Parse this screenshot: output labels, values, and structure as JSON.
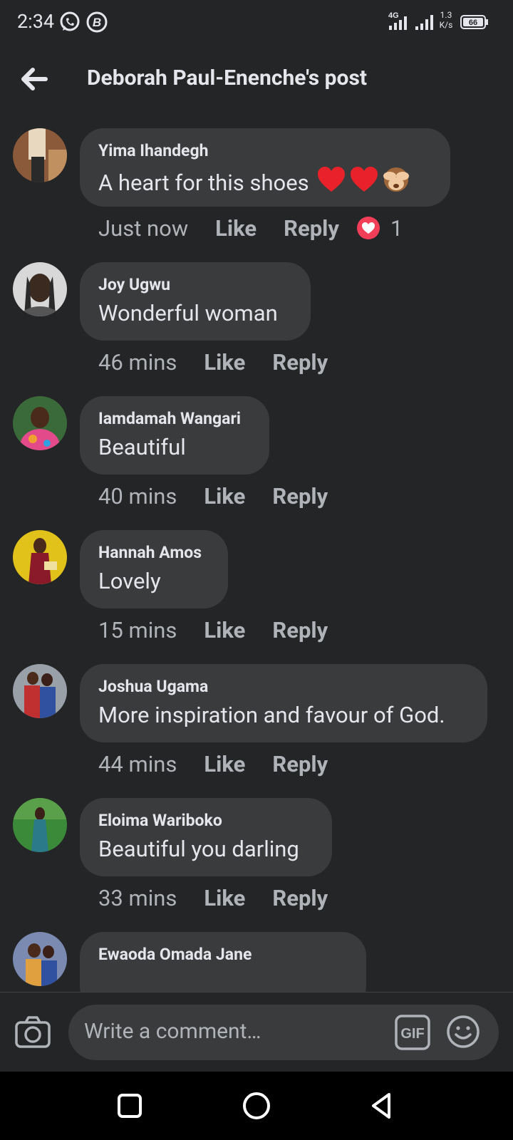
{
  "status_bar": {
    "time": "2:34",
    "network": "4G",
    "speed_value": "1.3",
    "speed_unit": "K/s",
    "battery": "66"
  },
  "header": {
    "title": "Deborah Paul-Enenche's post"
  },
  "actions": {
    "like": "Like",
    "reply": "Reply"
  },
  "comments": [
    {
      "author": "Yima Ihandegh",
      "text": "A heart for this shoes",
      "emoji": [
        "red-heart",
        "red-heart",
        "see-no-evil-monkey"
      ],
      "time": "Just now",
      "reaction_count": "1",
      "avatar_colors": [
        "#8a5a3a",
        "#e8d8c0"
      ]
    },
    {
      "author": "Joy Ugwu",
      "text": "Wonderful woman",
      "time": "46 mins",
      "avatar_colors": [
        "#d8d8d8",
        "#2a2a2a"
      ]
    },
    {
      "author": "Iamdamah Wangari",
      "text": "Beautiful",
      "time": "40 mins",
      "avatar_colors": [
        "#3a6a3a",
        "#e24a8a"
      ]
    },
    {
      "author": "Hannah Amos",
      "text": "Lovely",
      "time": "15 mins",
      "avatar_colors": [
        "#e0c21a",
        "#8a1a2a"
      ]
    },
    {
      "author": "Joshua Ugama",
      "text": "More inspiration and favour of God.",
      "time": "44 mins",
      "avatar_colors": [
        "#9aa0a8",
        "#c03030"
      ]
    },
    {
      "author": "Eloima Wariboko",
      "text": "Beautiful you darling",
      "time": "33 mins",
      "avatar_colors": [
        "#3a8a3a",
        "#2a7a8a"
      ]
    },
    {
      "author": "Ewaoda Omada Jane",
      "avatar_colors": [
        "#7a8ab0",
        "#e0a040"
      ]
    }
  ],
  "composer": {
    "placeholder": "Write a comment…",
    "gif_label": "GIF"
  }
}
